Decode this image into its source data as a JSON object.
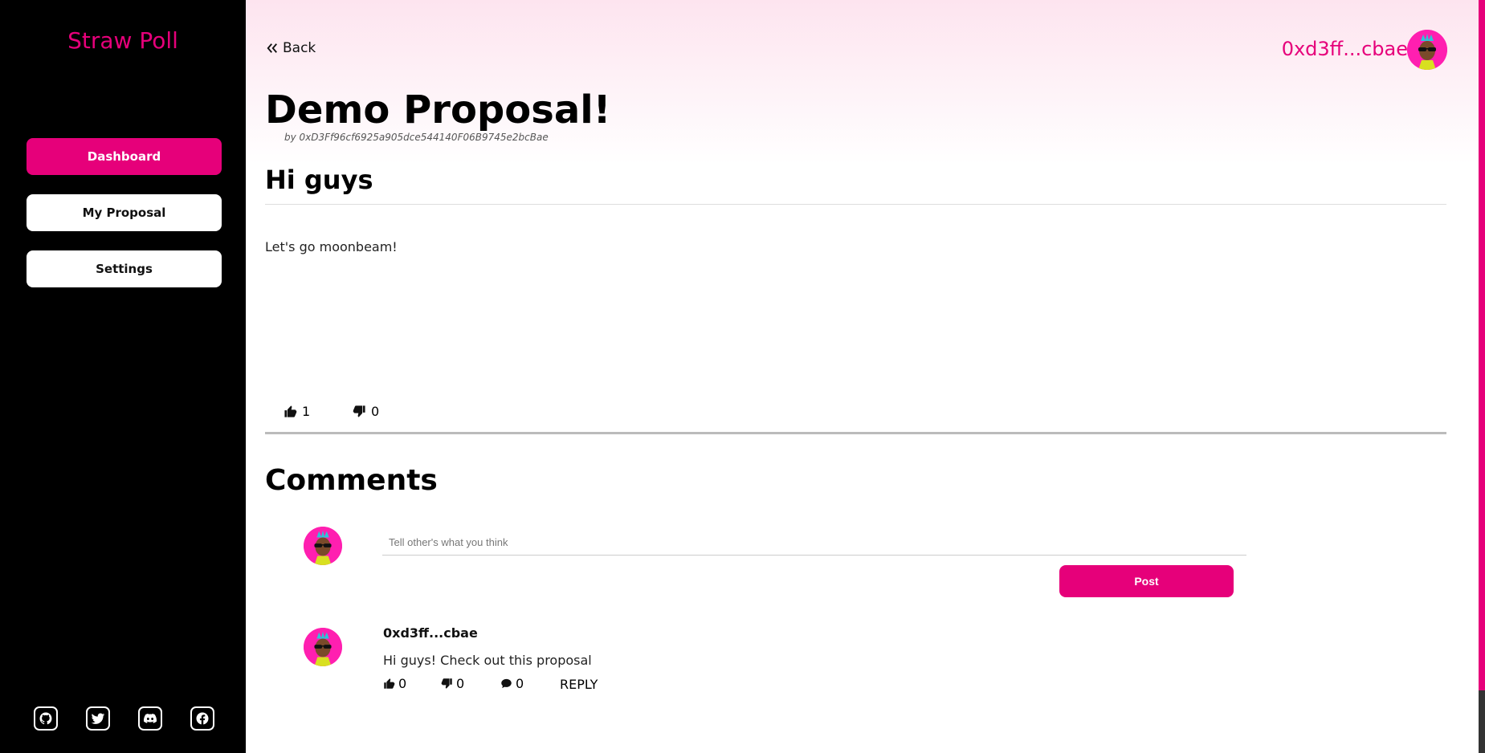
{
  "sidebar": {
    "brand": "Straw Poll",
    "nav": [
      {
        "label": "Dashboard",
        "active": true
      },
      {
        "label": "My Proposal",
        "active": false
      },
      {
        "label": "Settings",
        "active": false
      }
    ],
    "social_icons": [
      "github-icon",
      "twitter-icon",
      "discord-icon",
      "facebook-icon"
    ]
  },
  "header": {
    "back_label": "Back",
    "account": "0xd3ff...cbae"
  },
  "proposal": {
    "title": "Demo Proposal!",
    "author": "by 0xD3Ff96cf6925a905dce544140F06B9745e2bcBae",
    "subtitle": "Hi guys",
    "body": "Let's go moonbeam!",
    "upvotes": "1",
    "downvotes": "0"
  },
  "comments": {
    "title": "Comments",
    "input_placeholder": "Tell other's what you think",
    "input_value": "",
    "post_label": "Post",
    "items": [
      {
        "author": "0xd3ff...cbae",
        "text": "Hi guys! Check out this proposal",
        "likes": "0",
        "dislikes": "0",
        "replies": "0",
        "reply_label": "REPLY"
      }
    ]
  },
  "colors": {
    "accent": "#e6007a",
    "sidebar_bg": "#000000",
    "hero_gradient_top": "#fde4ef"
  }
}
